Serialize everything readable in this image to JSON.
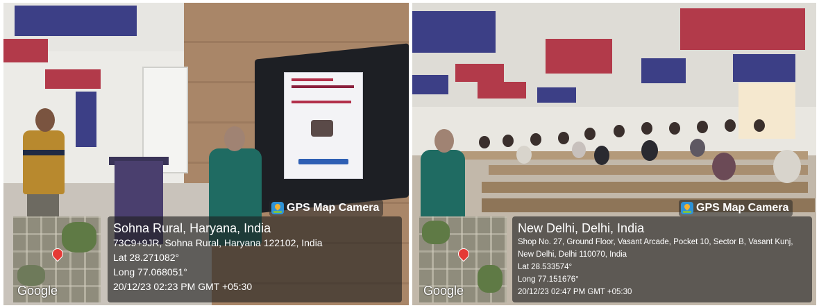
{
  "photos": [
    {
      "badge": "GPS Map Camera",
      "map_logo": "Google",
      "location": "Sohna Rural, Haryana, India",
      "address": "73C9+9JR, Sohna Rural, Haryana 122102, India",
      "lat": "Lat 28.271082°",
      "long": "Long 77.068051°",
      "datetime": "20/12/23 02:23 PM GMT +05:30"
    },
    {
      "badge": "GPS Map Camera",
      "map_logo": "Google",
      "location": "New Delhi, Delhi, India",
      "address": "Shop No. 27, Ground Floor, Vasant Arcade, Pocket 10, Sector B, Vasant Kunj, New Delhi, Delhi 110070, India",
      "lat": "Lat 28.533574°",
      "long": "Long 77.151676°",
      "datetime": "20/12/23 02:47 PM GMT +05:30"
    }
  ],
  "colors": {
    "overlay": "#1e1e1e",
    "badge_icon": "#2f93d6",
    "map_pin": "#e53935"
  }
}
